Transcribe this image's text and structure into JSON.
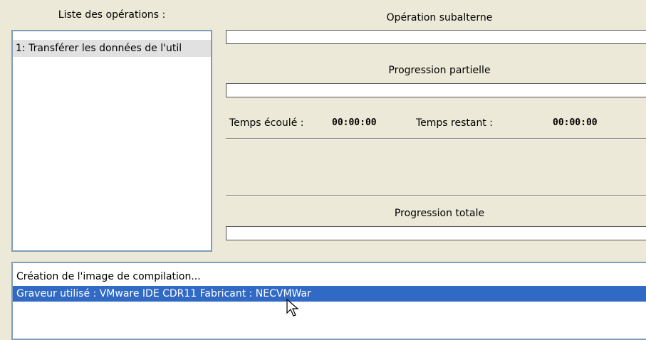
{
  "operations_panel": {
    "heading": "Liste des opérations :",
    "items": [
      {
        "label": "1: Transférer les données de l'util"
      }
    ]
  },
  "sub_operation": {
    "heading": "Opération subalterne",
    "progress_percent": 0
  },
  "partial_progress": {
    "heading": "Progression partielle",
    "progress_percent": 0
  },
  "timing": {
    "elapsed_label": "Temps écoulé :",
    "elapsed_value": "00:00:00",
    "remaining_label": "Temps restant :",
    "remaining_value": "00:00:00"
  },
  "total_progress": {
    "heading": "Progression totale",
    "progress_percent": 0
  },
  "log": {
    "lines": [
      {
        "text": "Création de l'image de compilation...",
        "selected": false
      },
      {
        "text": "Graveur utilisé : VMware IDE CDR11  Fabricant : NECVMWar",
        "selected": true
      }
    ]
  },
  "colors": {
    "selection": "#316ac5",
    "window_bg": "#ece9d8",
    "list_border": "#7f9db9"
  },
  "icons": {
    "cursor": "mouse-pointer-icon"
  }
}
